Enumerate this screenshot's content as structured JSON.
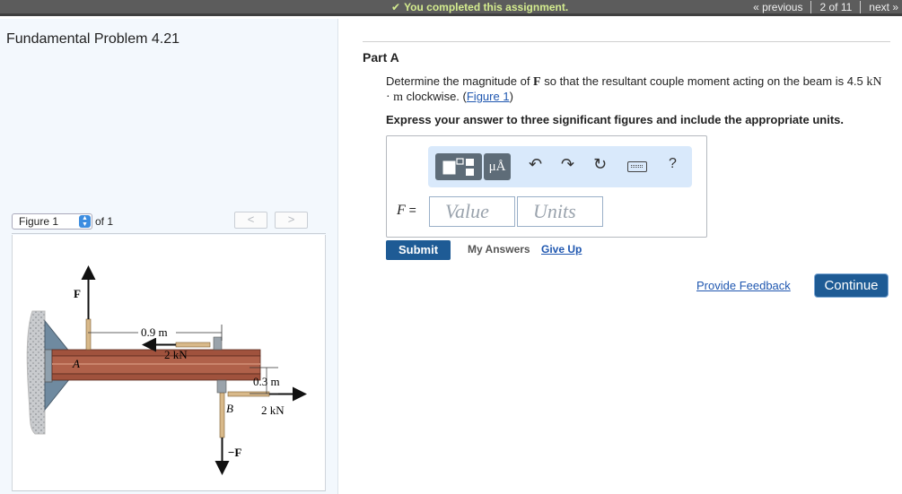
{
  "topbar": {
    "completed_check": "✔",
    "completed_text": "You completed this assignment.",
    "previous": "« previous",
    "position": "2 of 11",
    "next": "next »"
  },
  "left": {
    "problem_title": "Fundamental Problem 4.21",
    "figure_select": "Figure 1",
    "figure_of": "of 1",
    "prev_glyph": "<",
    "next_glyph": ">"
  },
  "figure": {
    "label_F": "F",
    "label_A": "A",
    "label_B": "B",
    "label_negF": "−F",
    "dim_09": "0.9 m",
    "dim_03": "0.3 m",
    "force_left": "2 kN",
    "force_right": "2 kN"
  },
  "part": {
    "title": "Part A",
    "q_before": "Determine the magnitude of ",
    "q_F": "F",
    "q_middle": " so that the resultant couple moment acting on the beam is 4.5 ",
    "q_units": "kN · m",
    "q_after": " clockwise. (",
    "q_link": "Figure 1",
    "q_close": ")",
    "instruction": "Express your answer to three significant figures and include the appropriate units."
  },
  "answer": {
    "mu_label": "μÅ",
    "undo_icon": "↶",
    "redo_icon": "↷",
    "reset_icon": "↻",
    "help_icon": "?",
    "f_symbol": "F",
    "f_eq": " =",
    "value_placeholder": "Value",
    "units_placeholder": "Units"
  },
  "actions": {
    "submit": "Submit",
    "my_answers": "My Answers",
    "give_up": "Give Up",
    "feedback": "Provide Feedback",
    "continue": "Continue"
  }
}
